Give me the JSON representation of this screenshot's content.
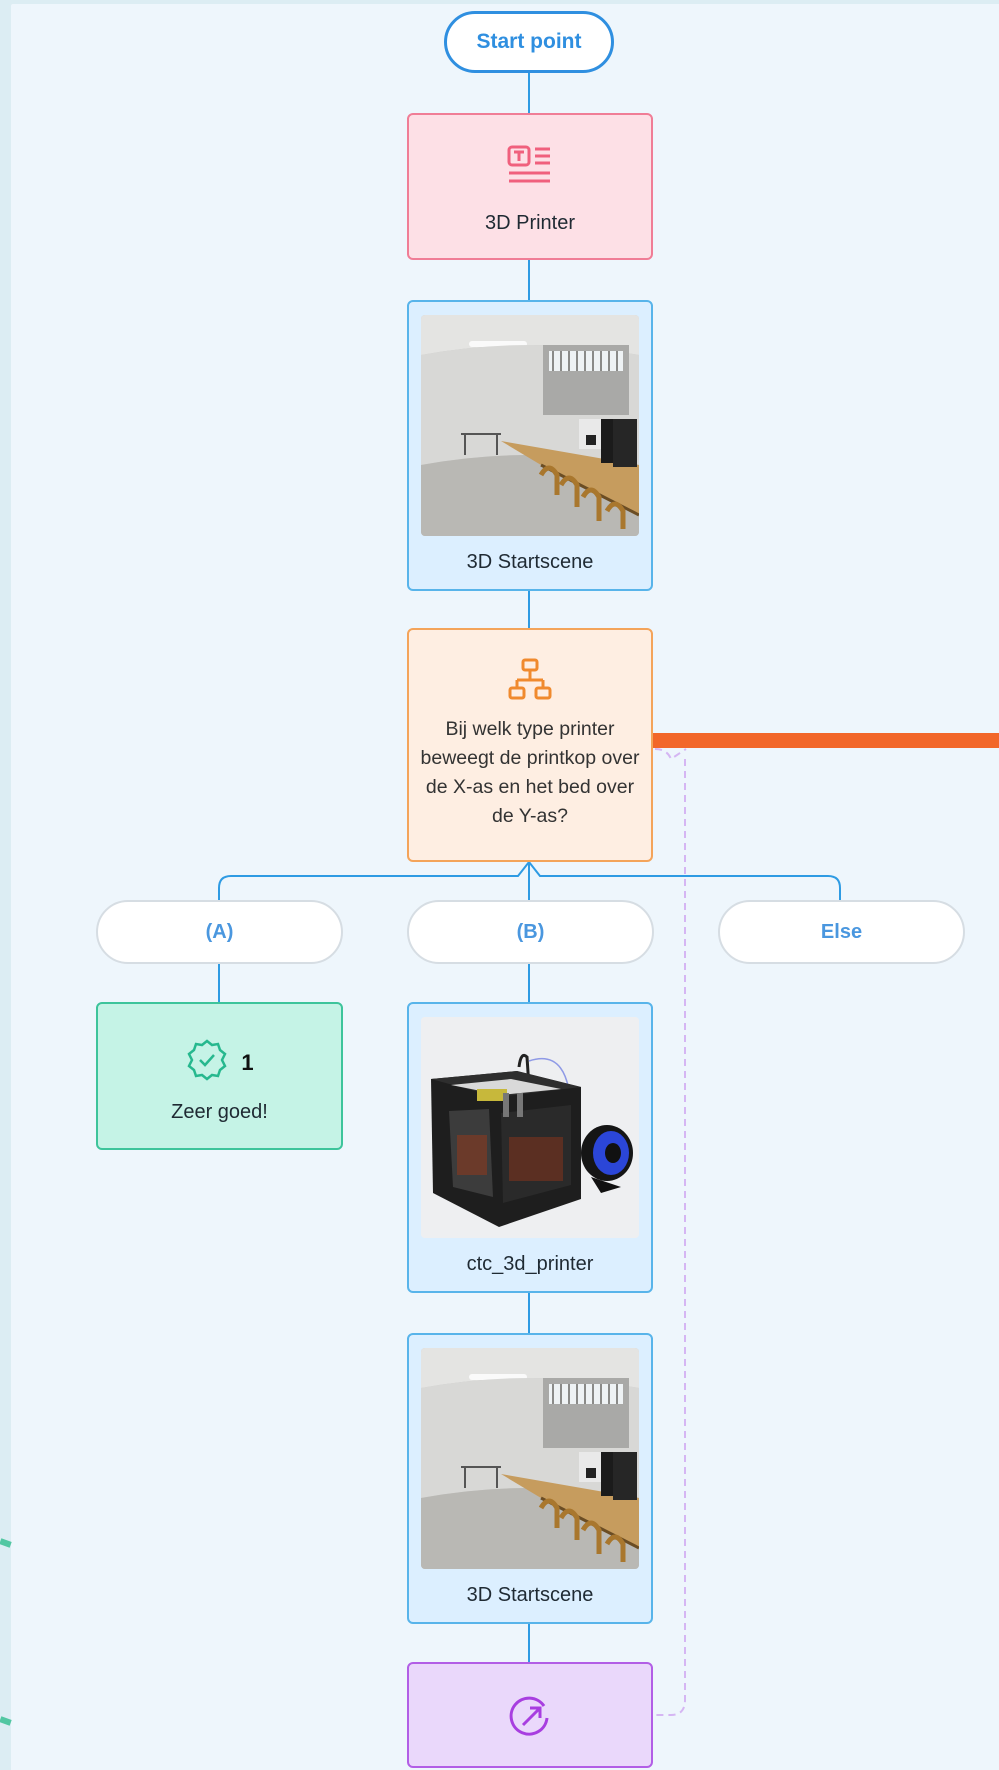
{
  "start": {
    "label": "Start point"
  },
  "text_node": {
    "label": "3D Printer",
    "icon": "text-document-icon"
  },
  "scene_node_1": {
    "label": "3D Startscene",
    "image": "classroom-panorama"
  },
  "branch_node": {
    "question": "Bij welk type printer beweegt de printkop over de X-as en het bed over de Y-as?",
    "icon": "hierarchy-icon"
  },
  "options": [
    {
      "label": "(A)"
    },
    {
      "label": "(B)"
    },
    {
      "label": "Else"
    }
  ],
  "score_node": {
    "points": "1",
    "label": "Zeer goed!",
    "icon": "check-badge-icon"
  },
  "model_node": {
    "label": "ctc_3d_printer",
    "image": "3d-printer-render"
  },
  "scene_node_2": {
    "label": "3D Startscene",
    "image": "classroom-panorama"
  },
  "link_node": {
    "icon": "jump-arrow-icon"
  },
  "colors": {
    "connector": "#2e9be3",
    "start": "#2f8fe0",
    "text_node": "#f07d96",
    "scene_node": "#58b4ea",
    "branch_node": "#f4a45a",
    "score_node": "#3dc49b",
    "link_node": "#b25ee6",
    "highlight": "#f2672a"
  }
}
